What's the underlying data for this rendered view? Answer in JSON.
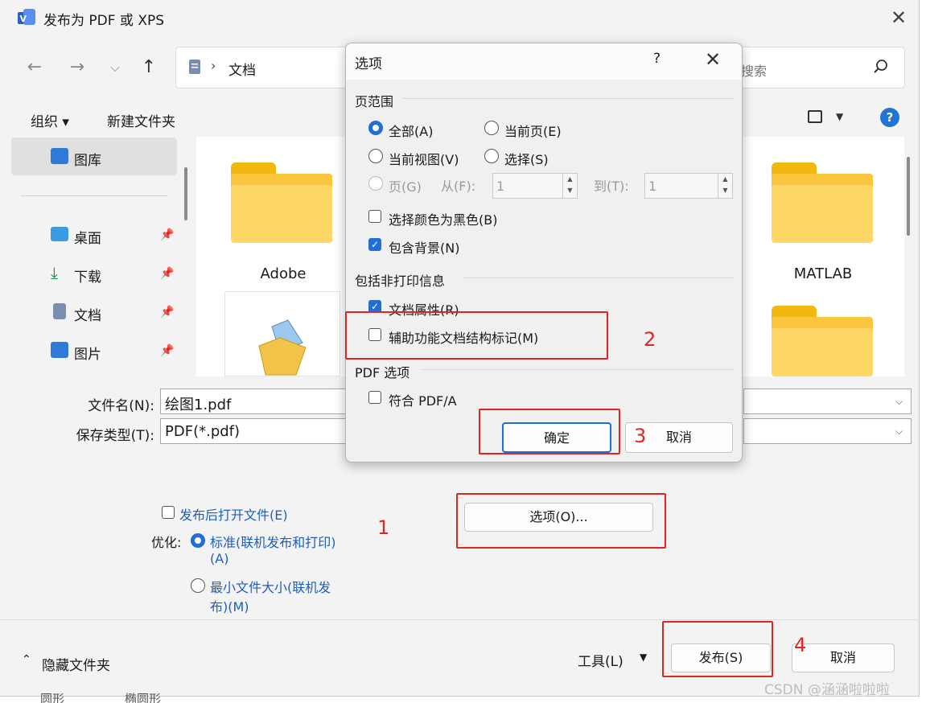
{
  "window": {
    "title": "发布为 PDF 或 XPS"
  },
  "address": {
    "path": "文档",
    "search_placeholder": "搜索"
  },
  "toolbar": {
    "organize": "组织 ▾",
    "new_folder": "新建文件夹",
    "help": "?"
  },
  "nav": {
    "items": [
      {
        "label": "图库",
        "icon": "gallery-icon"
      },
      {
        "label": "桌面",
        "icon": "desktop-icon"
      },
      {
        "label": "下载",
        "icon": "download-icon"
      },
      {
        "label": "文档",
        "icon": "document-icon"
      },
      {
        "label": "图片",
        "icon": "pictures-icon"
      }
    ]
  },
  "files": {
    "items": [
      "Adobe",
      "MATLAB"
    ]
  },
  "form": {
    "filename_label": "文件名(N):",
    "filename_value": "绘图1.pdf",
    "savetype_label": "保存类型(T):",
    "savetype_value": "PDF(*.pdf)",
    "open_after": "发布后打开文件(E)",
    "optimize_label": "优化:",
    "opt_standard_1": "标准(联机发布和打印)",
    "opt_standard_2": "(A)",
    "opt_min_1": "最小文件大小(联机发",
    "opt_min_2": "布)(M)",
    "options_button": "选项(O)..."
  },
  "footer": {
    "hide_folders": "隐藏文件夹",
    "tools": "工具(L)",
    "publish": "发布(S)",
    "cancel": "取消"
  },
  "dialog": {
    "title": "选项",
    "help": "?",
    "page_range_title": "页范围",
    "all": "全部(A)",
    "current_page": "当前页(E)",
    "current_view": "当前视图(V)",
    "selection": "选择(S)",
    "pages": "页(G)",
    "from_label": "从(F):",
    "from_value": "1",
    "to_label": "到(T):",
    "to_value": "1",
    "select_black": "选择颜色为黑色(B)",
    "include_bg": "包含背景(N)",
    "nonprint_title": "包括非打印信息",
    "doc_props": "文档属性(R)",
    "a11y_tags": "辅助功能文档结构标记(M)",
    "pdf_title": "PDF 选项",
    "pdfa": "符合 PDF/A",
    "ok": "确定",
    "cancel": "取消"
  },
  "annotations": {
    "n1": "1",
    "n2": "2",
    "n3": "3",
    "n4": "4"
  },
  "background_peek": {
    "a": "圆形",
    "b": "椭圆形"
  },
  "watermark": "CSDN @涵涵啦啦啦",
  "colors": {
    "accent": "#1f6fd6",
    "annotation_red": "#e32424",
    "folder": "#fbc53e"
  }
}
